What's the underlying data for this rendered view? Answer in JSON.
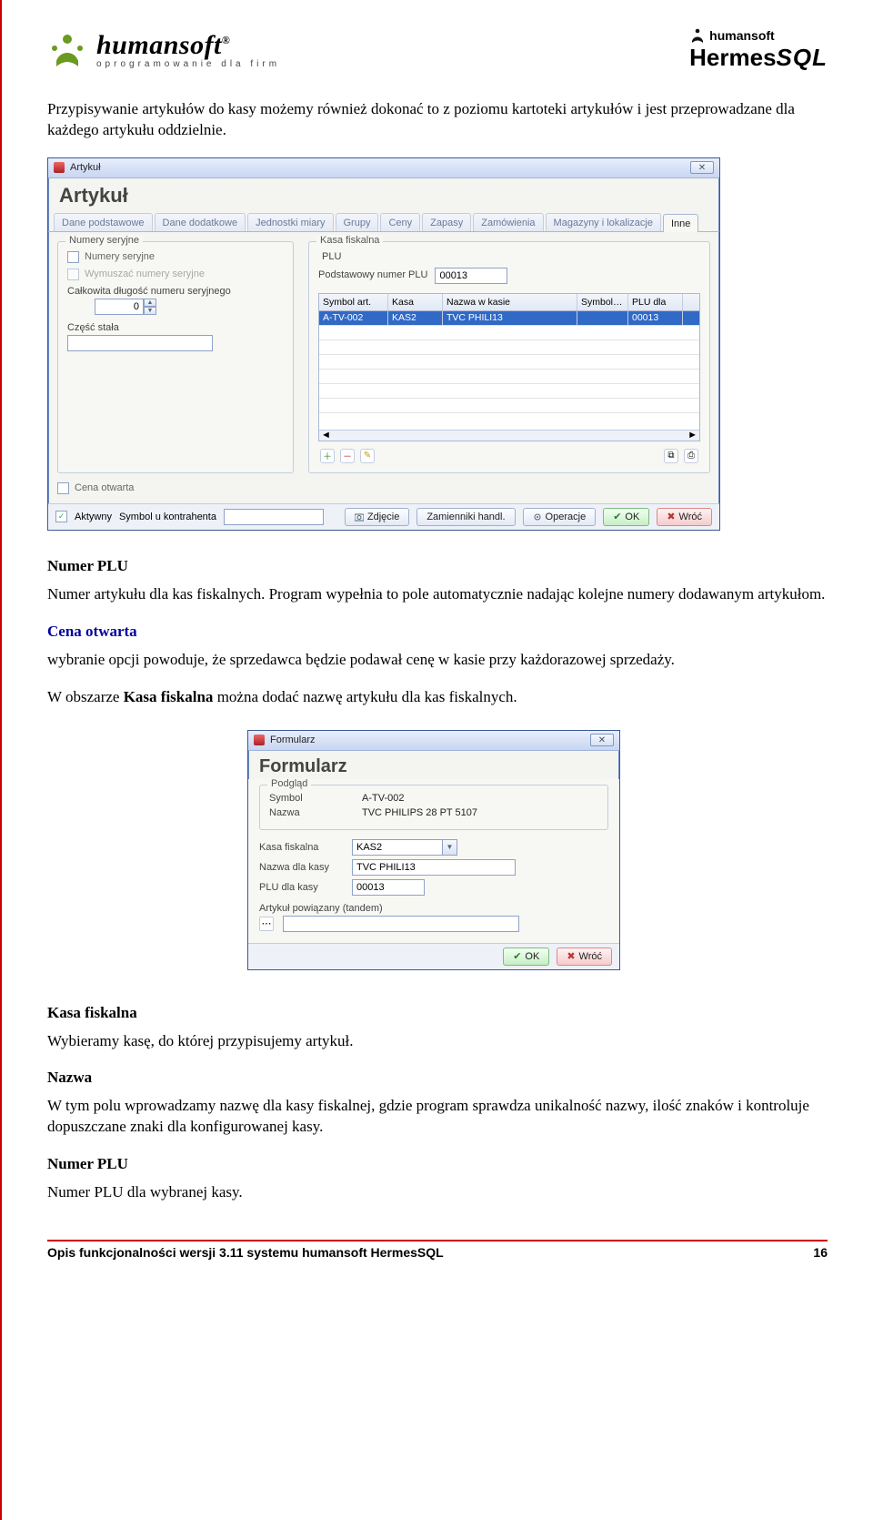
{
  "header": {
    "left_brand": "humansoft",
    "left_registered": "®",
    "left_tagline": "oprogramowanie dla firm",
    "right_small": "humansoft",
    "right_main": "Hermes",
    "right_suffix": "SQL"
  },
  "para_intro": "Przypisywanie artykułów do kasy możemy również dokonać to z poziomu kartoteki artykułów i jest przeprowadzane dla każdego artykułu oddzielnie.",
  "win1": {
    "title": "Artykuł",
    "heading": "Artykuł",
    "tabs": [
      "Dane podstawowe",
      "Dane dodatkowe",
      "Jednostki miary",
      "Grupy",
      "Ceny",
      "Zapasy",
      "Zamówienia",
      "Magazyny i lokalizacje",
      "Inne"
    ],
    "active_tab": 8,
    "left_group_title": "Numery seryjne",
    "chk_numery": "Numery seryjne",
    "chk_wymuszac": "Wymuszać numery seryjne",
    "lbl_dlugosc": "Całkowita długość numeru seryjnego",
    "val_dlugosc": "0",
    "lbl_czesc": "Część stała",
    "val_czesc": "",
    "right_group_title": "Kasa fiskalna",
    "lbl_plu_sub": "PLU",
    "lbl_podstawowy_plu": "Podstawowy numer PLU",
    "val_podstawowy_plu": "00013",
    "grid_headers": [
      "Symbol art.",
      "Kasa",
      "Nazwa w kasie",
      "Symbol art. pow.",
      "PLU dla"
    ],
    "grid_row": [
      "A-TV-002",
      "KAS2",
      "TVC PHILI13",
      "",
      "00013"
    ],
    "chk_cena_otwarta": "Cena otwarta",
    "chk_aktywny": "Aktywny",
    "bottom_label1": "Symbol u kontrahenta",
    "btn_zdjecie": "Zdjęcie",
    "btn_zamienniki": "Zamienniki handl.",
    "btn_operacje": "Operacje",
    "btn_ok": "OK",
    "btn_wroc": "Wróć"
  },
  "text_numer_plu_h": "Numer PLU",
  "text_numer_plu_body": "Numer artykułu dla kas fiskalnych. Program wypełnia to pole automatycznie nadając kolejne numery dodawanym artykułom.",
  "text_cena_h": "Cena otwarta",
  "text_cena_body": "wybranie opcji powoduje, że sprzedawca będzie podawał cenę w kasie przy każdorazowej sprzedaży.",
  "text_obszar_pre": "W obszarze ",
  "text_obszar_bold": "Kasa fiskalna",
  "text_obszar_post": " można dodać nazwę artykułu dla kas fiskalnych.",
  "win2": {
    "title": "Formularz",
    "heading": "Formularz",
    "lbl_podglad": "Podgląd",
    "lbl_symbol": "Symbol",
    "val_symbol": "A-TV-002",
    "lbl_nazwa": "Nazwa",
    "val_nazwa": "TVC PHILIPS 28 PT 5107",
    "lbl_kasa": "Kasa fiskalna",
    "val_kasa": "KAS2",
    "lbl_nazwa_kasy": "Nazwa dla kasy",
    "val_nazwa_kasy": "TVC PHILI13",
    "lbl_plu_kasy": "PLU dla kasy",
    "val_plu_kasy": "00013",
    "lbl_tandem": "Artykuł powiązany (tandem)",
    "btn_ok": "OK",
    "btn_wroc": "Wróć"
  },
  "text_kasa_h": "Kasa fiskalna",
  "text_kasa_body": "Wybieramy kasę, do której przypisujemy artykuł.",
  "text_nazwa_h": "Nazwa",
  "text_nazwa_body": "W tym polu wprowadzamy nazwę dla kasy fiskalnej, gdzie program sprawdza unikalność nazwy, ilość znaków i kontroluje dopuszczane znaki dla konfigurowanej kasy.",
  "text_plu2_h": "Numer PLU",
  "text_plu2_body": "Numer PLU dla wybranej kasy.",
  "footer": {
    "left": "Opis funkcjonalności wersji 3.11 systemu humansoft HermesSQL",
    "right": "16"
  }
}
